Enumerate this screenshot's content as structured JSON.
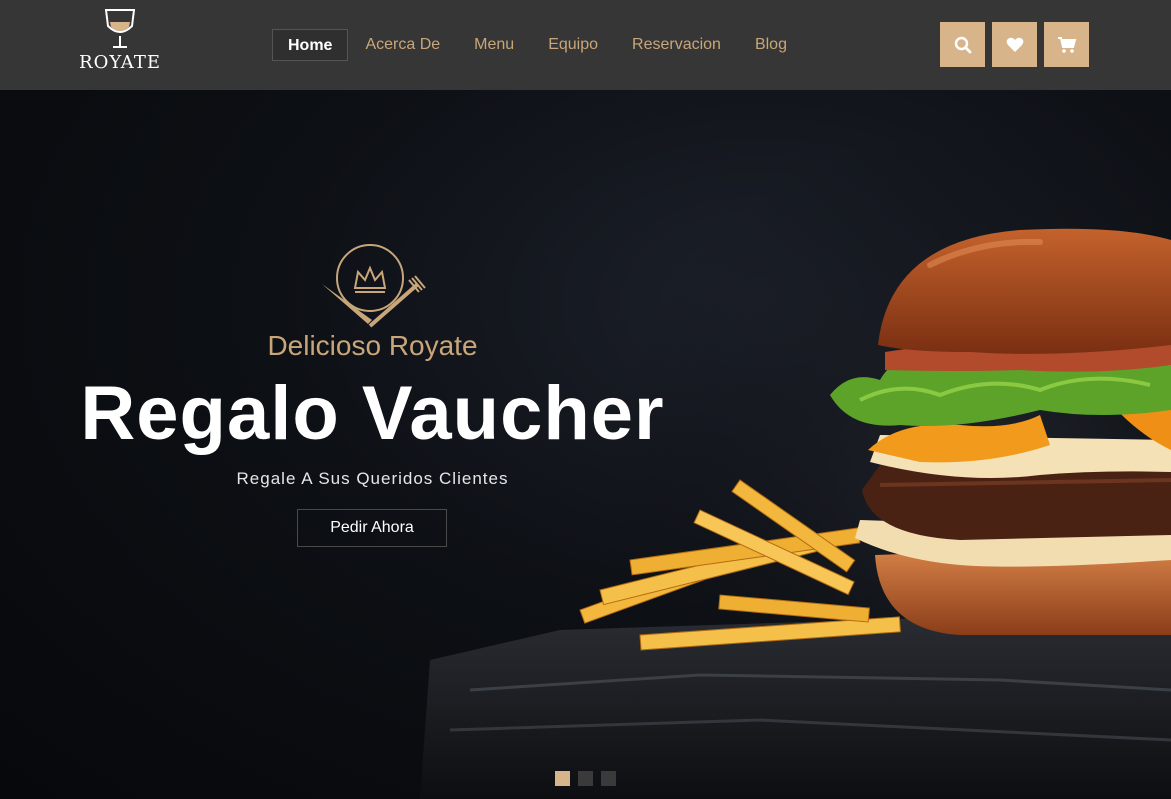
{
  "brand": {
    "name": "ROYATE"
  },
  "nav": {
    "links": [
      {
        "label": "Home",
        "active": true
      },
      {
        "label": "Acerca De",
        "active": false
      },
      {
        "label": "Menu",
        "active": false
      },
      {
        "label": "Equipo",
        "active": false
      },
      {
        "label": "Reservacion",
        "active": false
      },
      {
        "label": "Blog",
        "active": false
      }
    ],
    "icons": [
      "search-icon",
      "heart-icon",
      "cart-icon"
    ]
  },
  "hero": {
    "subtitle": "Delicioso Royate",
    "title": "Regalo Vaucher",
    "tagline": "Regale A Sus Queridos Clientes",
    "cta_label": "Pedir Ahora",
    "image": "burger-and-fries-photo",
    "slides": 3,
    "active_slide": 1
  },
  "colors": {
    "accent": "#d8b48a",
    "nav_bg": "#363636",
    "hero_bg": "#0b0d11",
    "link": "#c9a679"
  }
}
